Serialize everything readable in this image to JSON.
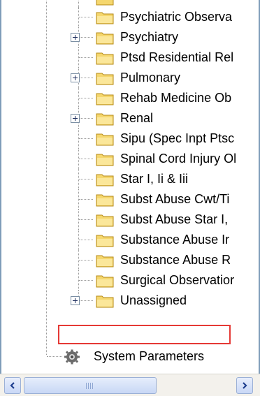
{
  "tree": {
    "items": [
      {
        "label": "Psychiatric Observa",
        "expandable": false
      },
      {
        "label": "Psychiatry",
        "expandable": true
      },
      {
        "label": "Ptsd Residential Rel",
        "expandable": false
      },
      {
        "label": "Pulmonary",
        "expandable": true
      },
      {
        "label": "Rehab Medicine Ob",
        "expandable": false
      },
      {
        "label": "Renal",
        "expandable": true
      },
      {
        "label": "Sipu (Spec Inpt Ptsc",
        "expandable": false
      },
      {
        "label": "Spinal Cord Injury Ol",
        "expandable": false
      },
      {
        "label": "Star I, Ii & Iii",
        "expandable": false
      },
      {
        "label": "Subst Abuse Cwt/Ti",
        "expandable": false
      },
      {
        "label": "Subst Abuse Star I,",
        "expandable": false
      },
      {
        "label": "Substance Abuse Ir",
        "expandable": false
      },
      {
        "label": "Substance Abuse R",
        "expandable": false
      },
      {
        "label": "Surgical Observatior",
        "expandable": false
      },
      {
        "label": "Unassigned",
        "expandable": true,
        "highlighted": true
      }
    ],
    "system_parameters_label": "System Parameters"
  },
  "colors": {
    "highlight_border": "#e53935",
    "folder_fill": "#f5d76e",
    "scrollbar_accent": "#9bb0d6"
  },
  "icons": {
    "folder": "folder-icon",
    "expand": "plus-expander-icon",
    "system": "gear-icon",
    "scroll_left": "arrow-left-icon",
    "scroll_right": "arrow-right-icon"
  }
}
